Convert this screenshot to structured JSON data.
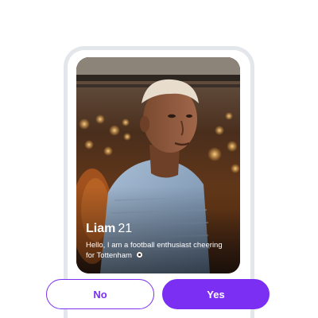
{
  "profile": {
    "name": "Liam",
    "age": "21",
    "bio": "Hello, I am a football enthusiast cheering for Tottenham",
    "bio_icon": "soccer-ball-icon"
  },
  "actions": {
    "no_label": "No",
    "yes_label": "Yes"
  },
  "colors": {
    "accent": "#7b2ff2",
    "phone_frame": "#e3e6ea"
  }
}
